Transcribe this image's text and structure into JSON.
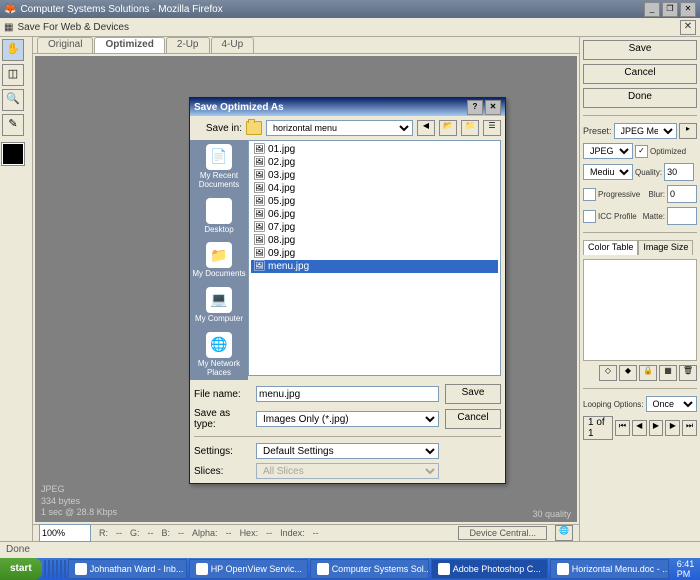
{
  "window": {
    "title": "Computer Systems Solutions - Mozilla Firefox"
  },
  "subwindow": {
    "title": "Save For Web & Devices"
  },
  "tabs": [
    "Original",
    "Optimized",
    "2-Up",
    "4-Up"
  ],
  "tabs_active_index": 1,
  "canvas": {
    "format": "JPEG",
    "size": "334 bytes",
    "time": "1 sec @ 28.8 Kbps",
    "quality": "30 quality"
  },
  "right": {
    "save": "Save",
    "cancel": "Cancel",
    "done": "Done",
    "preset_label": "Preset:",
    "preset_value": "JPEG Medium",
    "format": "JPEG",
    "optimized_label": "Optimized",
    "optimized_checked": true,
    "quality_label": "Quality:",
    "quality_value": "30",
    "compression": "Medium",
    "blur_label": "Blur:",
    "blur_value": "0",
    "progressive_label": "Progressive",
    "matte_label": "Matte:",
    "icc_label": "ICC Profile",
    "color_table_tab": "Color Table",
    "image_size_tab": "Image Size",
    "looping_label": "Looping Options:",
    "looping_value": "Once",
    "frame": "1 of 1"
  },
  "bottom": {
    "zoom": "100%",
    "r": "R:",
    "g": "G:",
    "b": "B:",
    "alpha": "Alpha:",
    "hex": "Hex:",
    "index": "Index:",
    "device": "Device Central..."
  },
  "status": "Done",
  "dialog": {
    "title": "Save Optimized As",
    "savein_label": "Save in:",
    "savein_value": "horizontal menu",
    "places": [
      "My Recent Documents",
      "Desktop",
      "My Documents",
      "My Computer",
      "My Network Places"
    ],
    "files": [
      "01.jpg",
      "02.jpg",
      "03.jpg",
      "04.jpg",
      "05.jpg",
      "06.jpg",
      "07.jpg",
      "08.jpg",
      "09.jpg",
      "menu.jpg"
    ],
    "selected_index": 9,
    "filename_label": "File name:",
    "filename": "menu.jpg",
    "saveas_label": "Save as type:",
    "saveas": "Images Only (*.jpg)",
    "settings_label": "Settings:",
    "settings": "Default Settings",
    "slices_label": "Slices:",
    "slices": "All Slices",
    "save": "Save",
    "cancel": "Cancel"
  },
  "taskbar": {
    "start": "start",
    "buttons": [
      "Johnathan Ward - Inb...",
      "HP OpenView Servic...",
      "Computer Systems Sol...",
      "Adobe Photoshop C...",
      "Horizontal Menu.doc - ..."
    ],
    "active_index": 3,
    "time": "6:41 PM"
  }
}
